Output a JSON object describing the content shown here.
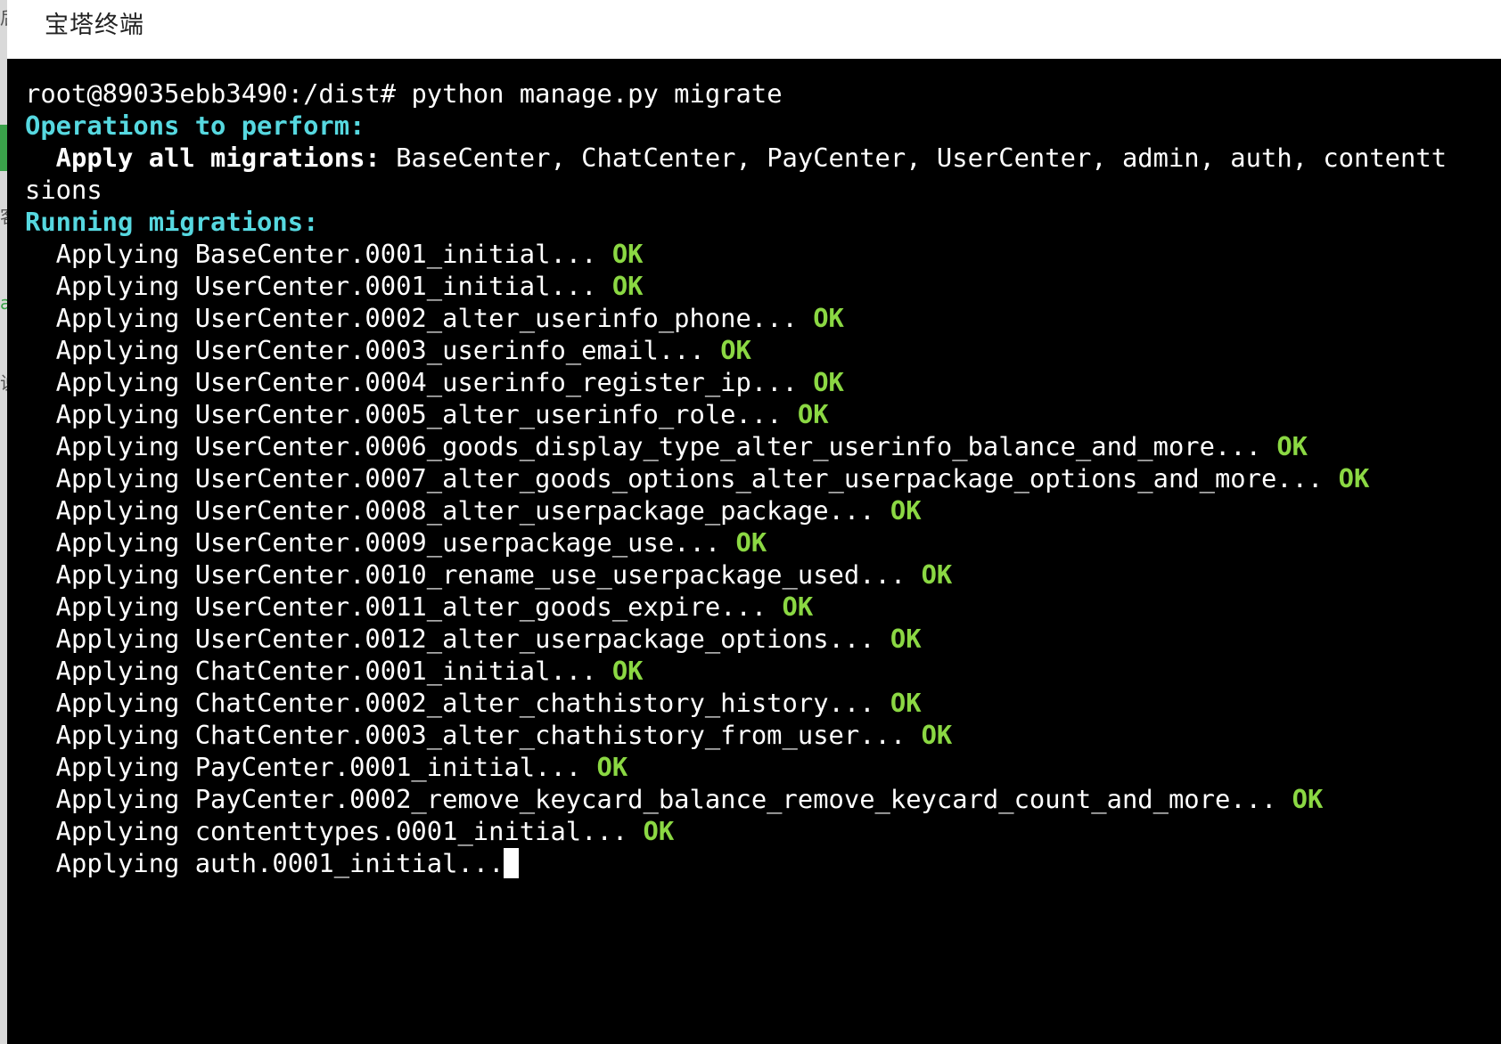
{
  "window": {
    "title": "宝塔终端"
  },
  "terminal": {
    "prompt": "root@89035ebb3490:/dist# ",
    "command": "python manage.py migrate",
    "operations_header": "Operations to perform:",
    "apply_all_label": "  Apply all migrations:",
    "apply_all_apps_line1": " BaseCenter, ChatCenter, PayCenter, UserCenter, admin, auth, contentt",
    "apply_all_apps_line2": "sions",
    "running_header": "Running migrations:",
    "migrations": [
      {
        "text": "  Applying BaseCenter.0001_initial... ",
        "status": "OK"
      },
      {
        "text": "  Applying UserCenter.0001_initial... ",
        "status": "OK"
      },
      {
        "text": "  Applying UserCenter.0002_alter_userinfo_phone... ",
        "status": "OK"
      },
      {
        "text": "  Applying UserCenter.0003_userinfo_email... ",
        "status": "OK"
      },
      {
        "text": "  Applying UserCenter.0004_userinfo_register_ip... ",
        "status": "OK"
      },
      {
        "text": "  Applying UserCenter.0005_alter_userinfo_role... ",
        "status": "OK"
      },
      {
        "text": "  Applying UserCenter.0006_goods_display_type_alter_userinfo_balance_and_more... ",
        "status": "OK"
      },
      {
        "text": "  Applying UserCenter.0007_alter_goods_options_alter_userpackage_options_and_more... ",
        "status": "OK"
      },
      {
        "text": "  Applying UserCenter.0008_alter_userpackage_package... ",
        "status": "OK"
      },
      {
        "text": "  Applying UserCenter.0009_userpackage_use... ",
        "status": "OK"
      },
      {
        "text": "  Applying UserCenter.0010_rename_use_userpackage_used... ",
        "status": "OK"
      },
      {
        "text": "  Applying UserCenter.0011_alter_goods_expire... ",
        "status": "OK"
      },
      {
        "text": "  Applying UserCenter.0012_alter_userpackage_options... ",
        "status": "OK"
      },
      {
        "text": "  Applying ChatCenter.0001_initial... ",
        "status": "OK"
      },
      {
        "text": "  Applying ChatCenter.0002_alter_chathistory_history... ",
        "status": "OK"
      },
      {
        "text": "  Applying ChatCenter.0003_alter_chathistory_from_user... ",
        "status": "OK"
      },
      {
        "text": "  Applying PayCenter.0001_initial... ",
        "status": "OK"
      },
      {
        "text": "  Applying PayCenter.0002_remove_keycard_balance_remove_keycard_count_and_more... ",
        "status": "OK"
      },
      {
        "text": "  Applying contenttypes.0001_initial... ",
        "status": "OK"
      }
    ],
    "current_line": "  Applying auth.0001_initial..."
  },
  "colors": {
    "background": "#000000",
    "foreground": "#ffffff",
    "header_cyan": "#56d8e0",
    "ok_green": "#8bd843"
  }
}
